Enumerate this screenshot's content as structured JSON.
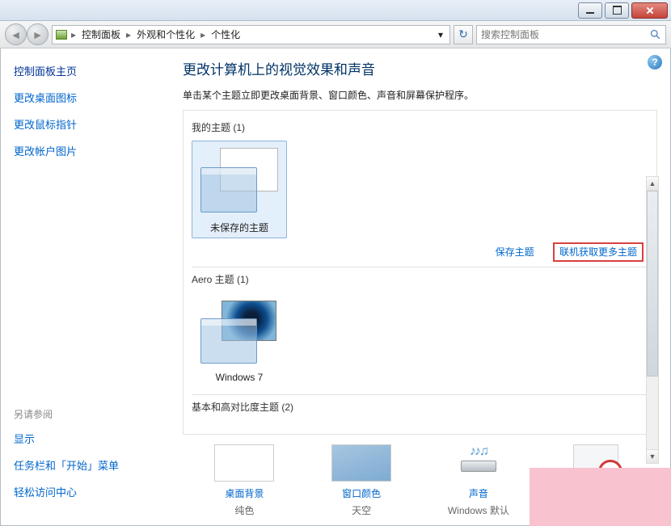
{
  "breadcrumb": {
    "item1": "控制面板",
    "item2": "外观和个性化",
    "item3": "个性化"
  },
  "search": {
    "placeholder": "搜索控制面板"
  },
  "sidebar": {
    "home": "控制面板主页",
    "links": [
      "更改桌面图标",
      "更改鼠标指针",
      "更改帐户图片"
    ],
    "footer_title": "另请参阅",
    "footer_links": [
      "显示",
      "任务栏和「开始」菜单",
      "轻松访问中心"
    ]
  },
  "main": {
    "title": "更改计算机上的视觉效果和声音",
    "subtitle": "单击某个主题立即更改桌面背景、窗口颜色、声音和屏幕保护程序。",
    "sections": {
      "my": "我的主题 (1)",
      "aero": "Aero 主题 (1)",
      "basic": "基本和高对比度主题 (2)"
    },
    "themes": {
      "unsaved": "未保存的主题",
      "win7": "Windows 7"
    },
    "save_link": "保存主题",
    "more_link": "联机获取更多主题"
  },
  "tiles": {
    "bg": {
      "title": "桌面背景",
      "sub": "纯色"
    },
    "wc": {
      "title": "窗口颜色",
      "sub": "天空"
    },
    "snd": {
      "title": "声音",
      "sub": "Windows 默认"
    },
    "ss": {
      "title": "",
      "sub": ""
    }
  }
}
